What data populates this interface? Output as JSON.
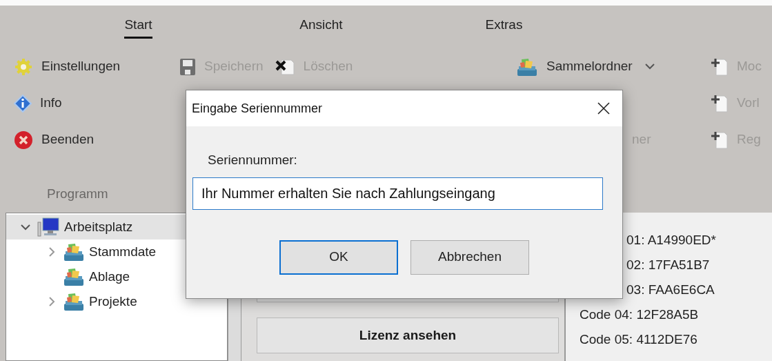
{
  "ribbon_tabs": [
    {
      "label": "Start",
      "selected": true
    },
    {
      "label": "Ansicht",
      "selected": false
    },
    {
      "label": "Extras",
      "selected": false
    }
  ],
  "ribbon_groups": [
    {
      "label": "Programm",
      "items": [
        {
          "label": "Einstellungen",
          "kind": "gear",
          "disabled": false
        },
        {
          "label": "Info",
          "kind": "info",
          "disabled": false
        },
        {
          "label": "Beenden",
          "kind": "exit",
          "disabled": false
        }
      ]
    },
    {
      "items": [
        {
          "label": "Speichern",
          "kind": "save",
          "disabled": true
        },
        {
          "label": "Löschen",
          "kind": "delete",
          "disabled": true
        }
      ]
    },
    {
      "items": [
        {
          "label": "Sammelordner",
          "kind": "collection",
          "disabled": false,
          "dropdown": true
        },
        {
          "label": "ner",
          "kind": "none",
          "disabled": true
        }
      ]
    },
    {
      "items": [
        {
          "label": "Moc",
          "kind": "docplus",
          "disabled": true
        },
        {
          "label": "Vorl",
          "kind": "docplus",
          "disabled": true
        },
        {
          "label": "Reg",
          "kind": "docplus",
          "disabled": true
        }
      ]
    }
  ],
  "tree": [
    {
      "label": "Arbeitsplatz",
      "kind": "computer",
      "expanded": true,
      "selected": true,
      "children": [
        {
          "label": "Stammdate",
          "kind": "collection",
          "expanded": false,
          "selected": false
        },
        {
          "label": "Ablage",
          "kind": "collection",
          "selected": false
        },
        {
          "label": "Projekte",
          "kind": "collection",
          "expanded": false,
          "selected": false
        }
      ]
    }
  ],
  "action_buttons": [
    {
      "label": "Lizenz ansehen"
    }
  ],
  "codes": [
    "01: A14990ED*",
    "02: 17FA51B7",
    "03: FAA6E6CA",
    "Code 04: 12F28A5B",
    "Code 05: 4112DE76"
  ],
  "dialog": {
    "title": "Eingabe Seriennummer",
    "field_label": "Seriennummer:",
    "value": "Ihr Nummer erhalten Sie nach Zahlungseingang",
    "buttons": [
      {
        "label": "OK",
        "default": true
      },
      {
        "label": "Abbrechen",
        "default": false
      }
    ]
  }
}
